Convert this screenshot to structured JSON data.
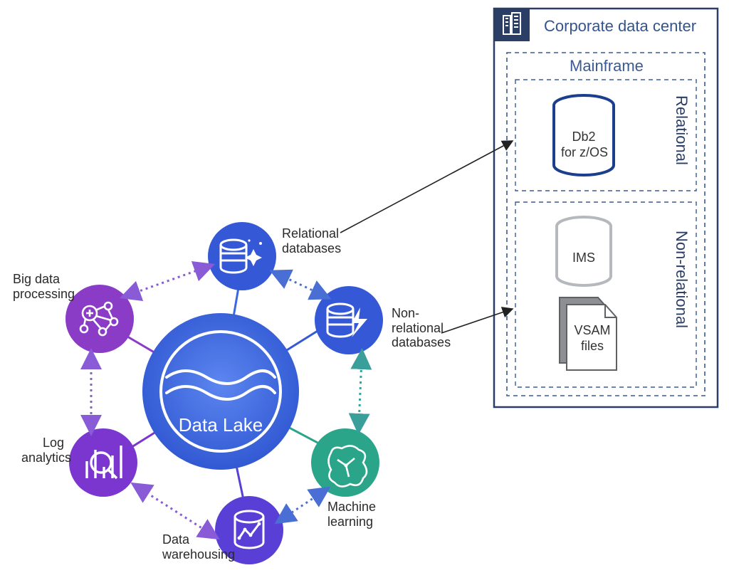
{
  "center": {
    "label": "Data Lake"
  },
  "nodes": {
    "relational": {
      "label": "Relational\ndatabases"
    },
    "nonrelational": {
      "label": "Non-\nrelational\ndatabases"
    },
    "ml": {
      "label": "Machine\nlearning"
    },
    "warehouse": {
      "label": "Data\nwarehousing"
    },
    "log": {
      "label": "Log\nanalytics"
    },
    "bigdata": {
      "label": "Big data\nprocessing"
    }
  },
  "corporate": {
    "title": "Corporate data center",
    "mainframe": "Mainframe",
    "relational": {
      "heading": "Relational",
      "db2_line1": "Db2",
      "db2_line2": "for z/OS"
    },
    "nonrelational": {
      "heading": "Non-relational",
      "ims": "IMS",
      "vsam_line1": "VSAM",
      "vsam_line2": "files"
    }
  },
  "colors": {
    "centerFill": "#3a68e0",
    "blue": "#3559d6",
    "teal": "#2aa58a",
    "indigo": "#5a3fd6",
    "purple": "#7a36cf",
    "violet": "#8a3cc6",
    "violet2": "#7d34c4",
    "boxBorder": "#2b3f66",
    "db2": "#1b3f8c",
    "grey": "#9aa0a5"
  }
}
